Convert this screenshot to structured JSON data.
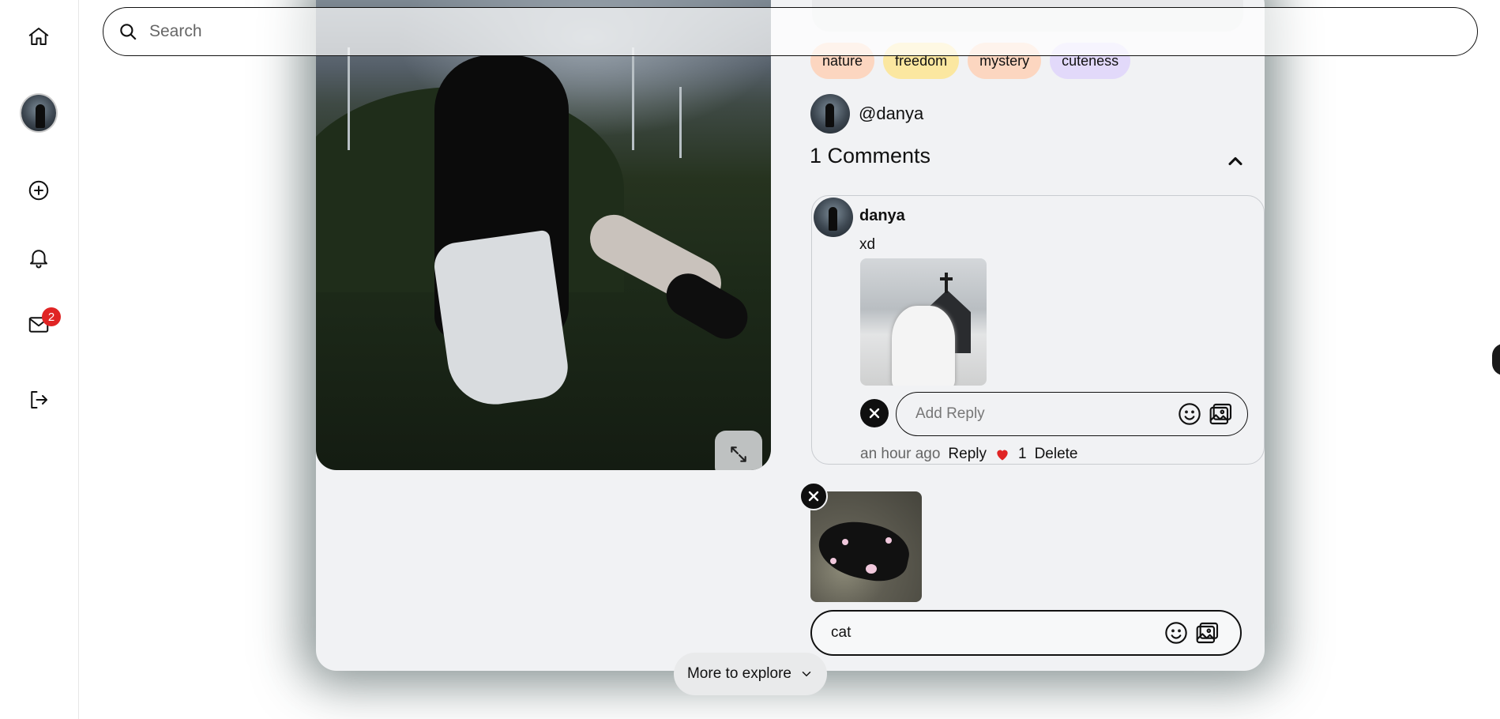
{
  "sidebar": {
    "items": [
      {
        "name": "home",
        "icon": "home-icon"
      },
      {
        "name": "profile",
        "icon": "avatar"
      },
      {
        "name": "create",
        "icon": "plus-circle-icon"
      },
      {
        "name": "notifications",
        "icon": "bell-icon"
      },
      {
        "name": "messages",
        "icon": "mail-icon",
        "badge": "2"
      },
      {
        "name": "logout",
        "icon": "logout-icon"
      }
    ]
  },
  "search": {
    "placeholder": "Search"
  },
  "pin": {
    "tags": [
      "nature",
      "freedom",
      "mystery",
      "cuteness"
    ],
    "author_handle": "@danya"
  },
  "comments": {
    "header": "1 Comments",
    "items": [
      {
        "user": "danya",
        "text": "xd",
        "time": "an hour ago",
        "reply_label": "Reply",
        "likes": "1",
        "delete_label": "Delete",
        "reply_placeholder": "Add Reply"
      }
    ],
    "draft_text": "cat"
  },
  "explore_label": "More to explore",
  "colors": {
    "badge": "#e02424",
    "tag_nature": "#fcd6c0",
    "tag_freedom": "#fbe7a0",
    "tag_mystery": "#fcd6c0",
    "tag_cuteness": "#e2d9fa",
    "heart": "#e02424"
  }
}
